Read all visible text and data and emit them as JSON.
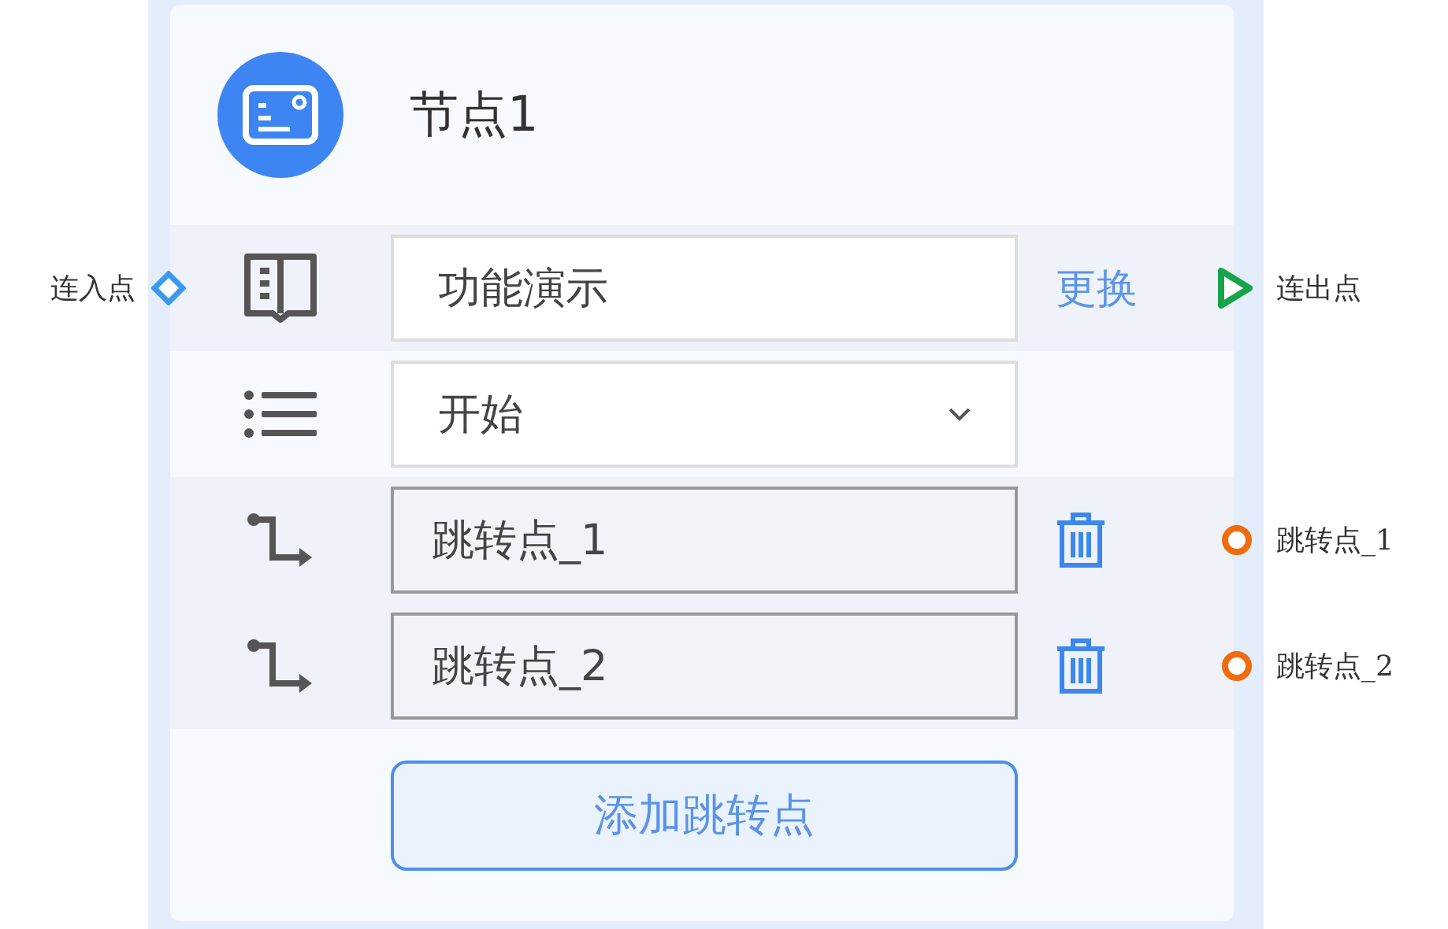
{
  "node": {
    "title": "节点1"
  },
  "rows": [
    {
      "kind": "text",
      "value": "功能演示",
      "action": "更换",
      "in_port_label": "连入点",
      "port_label": "连出点"
    },
    {
      "kind": "select",
      "value": "开始"
    },
    {
      "kind": "jump",
      "value": "跳转点_1",
      "port_label": "跳转点_1"
    },
    {
      "kind": "jump",
      "value": "跳转点_2",
      "port_label": "跳转点_2"
    }
  ],
  "add_button": "添加跳转点"
}
